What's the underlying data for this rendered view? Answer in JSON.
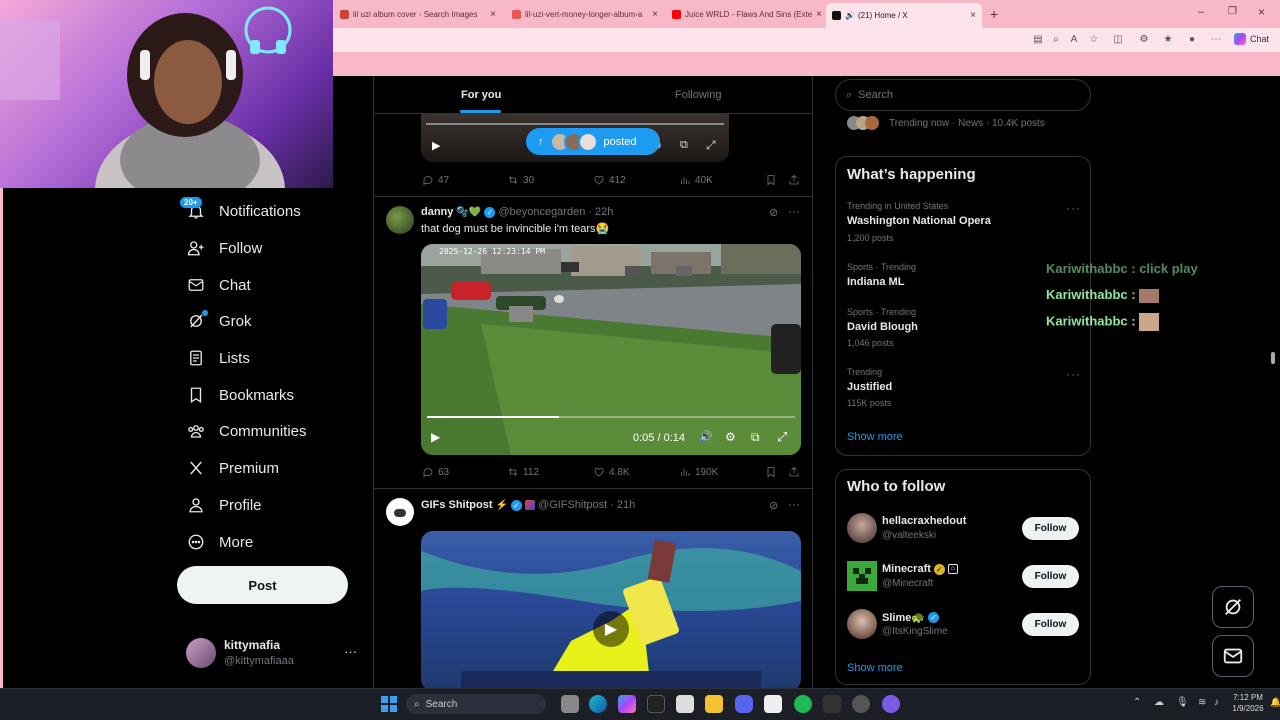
{
  "browser": {
    "tabs": [
      {
        "label": "lil uzi album cover - Search Images"
      },
      {
        "label": "lil-uzi-vert-money-longer-album-a"
      },
      {
        "label": "Juice WRLD - Flaws And Sins (Exte"
      },
      {
        "label": "(21) Home / X"
      }
    ],
    "chat_label": "Chat"
  },
  "sidebar": {
    "badge": "20+",
    "items": [
      {
        "label": "Notifications",
        "icon": "bell-icon"
      },
      {
        "label": "Follow",
        "icon": "add-person-icon"
      },
      {
        "label": "Chat",
        "icon": "mail-icon"
      },
      {
        "label": "Grok",
        "icon": "grok-icon"
      },
      {
        "label": "Lists",
        "icon": "list-icon"
      },
      {
        "label": "Bookmarks",
        "icon": "bookmark-icon"
      },
      {
        "label": "Communities",
        "icon": "communities-icon"
      },
      {
        "label": "Premium",
        "icon": "x-logo-icon"
      },
      {
        "label": "Profile",
        "icon": "person-icon"
      },
      {
        "label": "More",
        "icon": "more-circle-icon"
      }
    ],
    "post_label": "Post",
    "account": {
      "name": "kittymafia",
      "handle": "@kittymafiaaa"
    }
  },
  "feed": {
    "tabs": {
      "for_you": "For you",
      "following": "Following"
    },
    "posted_pill": "posted",
    "tweet0_stats": {
      "replies": "47",
      "reposts": "30",
      "likes": "412",
      "views": "40K"
    },
    "tweet1": {
      "name": "danny",
      "handle": "@beyoncegarden",
      "time": "· 22h",
      "text": "that dog must be invincible i'm tears😭",
      "video_timestamp": "2025-12-26 12:23:14 PM",
      "video_time": "0:05 / 0:14",
      "progress": 0.36,
      "stats": {
        "replies": "63",
        "reposts": "112",
        "likes": "4.8K",
        "views": "190K"
      }
    },
    "tweet2": {
      "name": "GIFs Shitpost",
      "handle": "@GIFShitpost",
      "time": "· 21h"
    }
  },
  "right": {
    "search_placeholder": "Search",
    "trending_now": "Trending now · News · 10.4K posts",
    "whats_happening": "What’s happening",
    "trends": [
      {
        "meta": "Trending in United States",
        "name": "Washington National Opera",
        "count": "1,200 posts"
      },
      {
        "meta": "Sports · Trending",
        "name": "Indiana ML",
        "count": ""
      },
      {
        "meta": "Sports · Trending",
        "name": "David Blough",
        "count": "1,046 posts"
      },
      {
        "meta": "Trending",
        "name": "Justified",
        "count": "115K posts"
      }
    ],
    "show_more": "Show more",
    "who_to_follow": "Who to follow",
    "follow_suggestions": [
      {
        "name": "hellacraxhedout",
        "handle": "@valteekski"
      },
      {
        "name": "Minecraft",
        "handle": "@Minecraft"
      },
      {
        "name": "Slime🐢",
        "handle": "@ItsKingSlime"
      }
    ],
    "follow_label": "Follow",
    "show_more_2": "Show more"
  },
  "stream_chat": [
    {
      "user": "Kariwithabbc",
      "msg": ": click play"
    },
    {
      "user": "Kariwithabbc",
      "msg": ":"
    },
    {
      "user": "Kariwithabbc",
      "msg": ":"
    }
  ],
  "taskbar": {
    "search": "Search",
    "time": "7:12 PM",
    "date": "1/9/2026"
  },
  "colors": {
    "accent": "#1d9bf0",
    "tab_pink": "#f7b8c8",
    "chat_green": "#8ee6a0"
  }
}
